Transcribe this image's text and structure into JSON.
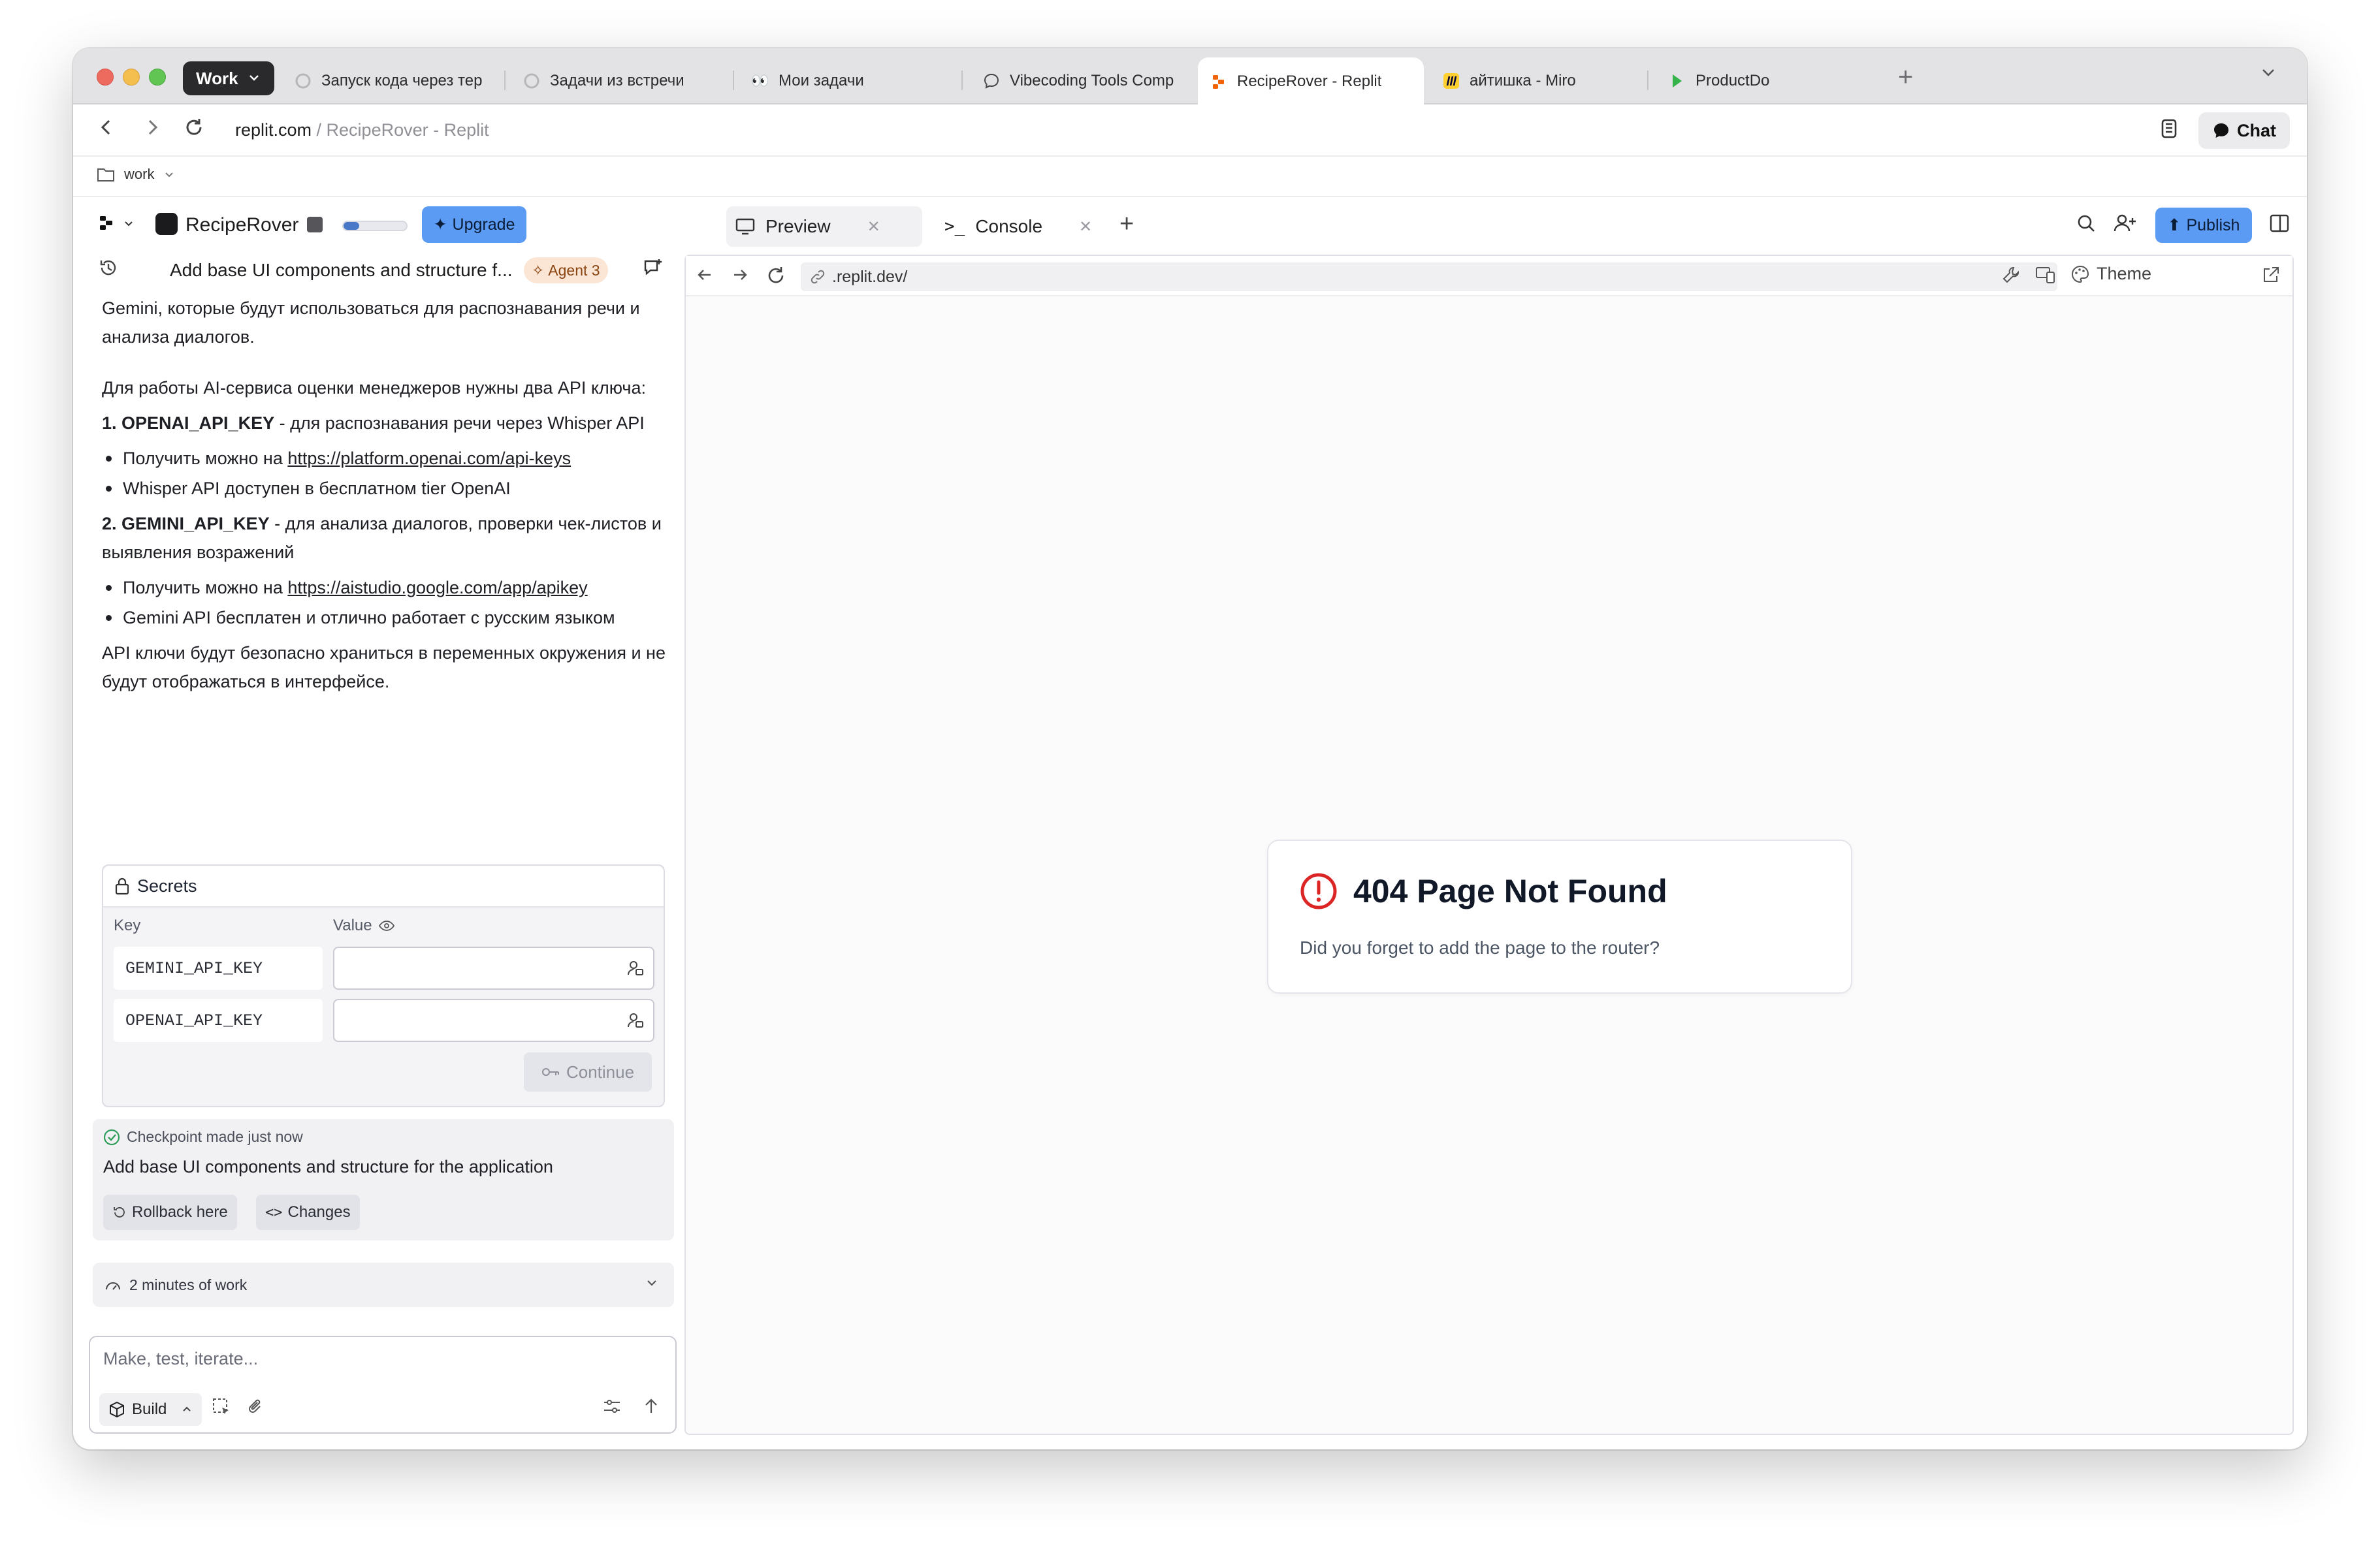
{
  "browser": {
    "workspace": "Work",
    "tabs": [
      {
        "title": "Запуск кода через тер",
        "icon": "spinner-icon"
      },
      {
        "title": "Задачи из встречи",
        "icon": "spinner-icon"
      },
      {
        "title": "Мои задачи",
        "icon": "eyes-icon"
      },
      {
        "title": "Vibecoding Tools Comp",
        "icon": "chat-bubble-icon"
      },
      {
        "title": "RecipeRover - Replit",
        "icon": "replit-icon",
        "active": true
      },
      {
        "title": "айтишка - Miro",
        "icon": "miro-icon"
      },
      {
        "title": "ProductDo",
        "icon": "productdo-icon"
      }
    ],
    "url_host": "replit.com",
    "url_path": " / RecipeRover - Replit",
    "chat_label": "Chat",
    "bookmark_folder": "work"
  },
  "toolbar": {
    "project_name": "RecipeRover",
    "progress": 0.25,
    "upgrade_label": "Upgrade",
    "pane_tabs": [
      {
        "label": "Preview",
        "active": true
      },
      {
        "label": "Console"
      }
    ],
    "publish_label": "Publish"
  },
  "chat": {
    "title": "Add base UI components and structure f...",
    "agent_badge": "Agent 3",
    "intro_text": "Gemini, которые будут использоваться для распознавания речи и анализа диалогов.",
    "para1": "Для работы AI-сервиса оценки менеджеров нужны два API ключа:",
    "key1_name": "1. OPENAI_API_KEY",
    "key1_desc": " - для распознавания речи через Whisper API",
    "key1_b1_prefix": "Получить можно на ",
    "key1_b1_link": "https://platform.openai.com/api-keys",
    "key1_b2": "Whisper API доступен в бесплатном tier OpenAI",
    "key2_name": "2. GEMINI_API_KEY",
    "key2_desc": " - для анализа диалогов, проверки чек-листов и выявления возражений",
    "key2_b1_prefix": "Получить можно на ",
    "key2_b1_link": "https://aistudio.google.com/app/apikey",
    "key2_b2": "Gemini API бесплатен и отлично работает с русским языком",
    "para_end": "API ключи будут безопасно храниться в переменных окружения и не будут отображаться в интерфейсе."
  },
  "secrets": {
    "title": "Secrets",
    "key_header": "Key",
    "value_header": "Value",
    "rows": [
      {
        "key": "GEMINI_API_KEY",
        "value": ""
      },
      {
        "key": "OPENAI_API_KEY",
        "value": ""
      }
    ],
    "continue_label": "Continue"
  },
  "checkpoint": {
    "status": "Checkpoint made just now",
    "description": "Add base UI components and structure for the application",
    "rollback_label": "Rollback here",
    "changes_label": "Changes"
  },
  "work_summary": "2 minutes of work",
  "composer": {
    "placeholder": "Make, test, iterate...",
    "mode_label": "Build"
  },
  "preview": {
    "url": ".replit.dev/",
    "theme_label": "Theme",
    "error_title": "404 Page Not Found",
    "error_message": "Did you forget to add the page to the router?"
  },
  "colors": {
    "accent_blue": "#5b9bf4",
    "error_red": "#dc2626",
    "agent_badge_bg": "#fbe6d5"
  }
}
